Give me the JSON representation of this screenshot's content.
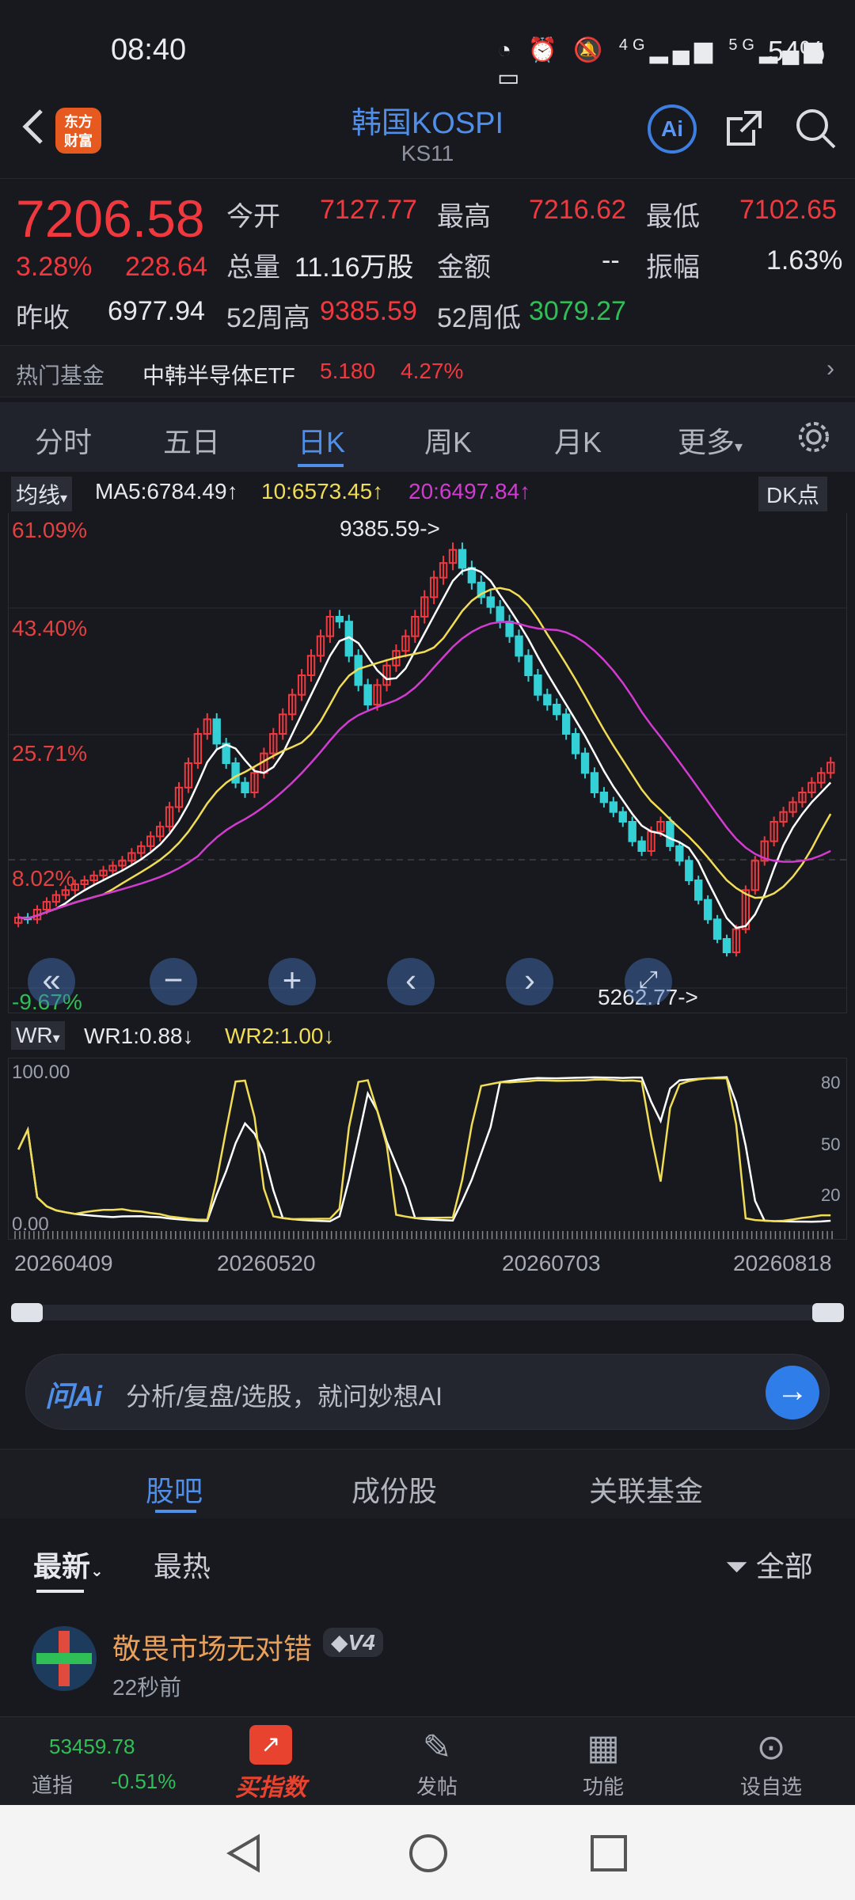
{
  "status": {
    "time": "08:40",
    "network1": "4G",
    "network2": "5G",
    "battery": "54%"
  },
  "header": {
    "logo_top": "东方",
    "logo_bottom": "财富",
    "title": "韩国KOSPI",
    "subtitle": "KS11",
    "ai_label": "Ai"
  },
  "quote": {
    "price": "7206.58",
    "change_pct": "3.28%",
    "change_abs": "228.64",
    "open_label": "今开",
    "open": "7127.77",
    "high_label": "最高",
    "high": "7216.62",
    "low_label": "最低",
    "low": "7102.65",
    "volume_label": "总量",
    "volume": "11.16万股",
    "amount_label": "金额",
    "amount": "--",
    "amp_label": "振幅",
    "amp": "1.63%",
    "prev_label": "昨收",
    "prev": "6977.94",
    "w52h_label": "52周高",
    "w52h": "9385.59",
    "w52l_label": "52周低",
    "w52l": "3079.27"
  },
  "hot_fund": {
    "label": "热门基金",
    "name": "中韩半导体ETF",
    "price": "5.180",
    "pct": "4.27%"
  },
  "period_tabs": [
    "分时",
    "五日",
    "日K",
    "周K",
    "月K",
    "更多"
  ],
  "active_tab": "日K",
  "ma": {
    "selector": "均线",
    "ma5": "MA5:6784.49↑",
    "ma10": "10:6573.45↑",
    "ma20": "20:6497.84↑",
    "dk": "DK点"
  },
  "chart_data": {
    "type": "candlestick",
    "pct_labels": [
      "61.09%",
      "43.40%",
      "25.71%",
      "8.02%",
      "-9.67%"
    ],
    "high_marker": "9385.59->",
    "low_marker": "5262.77->",
    "date_labels": [
      "20260409",
      "20260520",
      "20260703",
      "20260818"
    ],
    "close_values": [
      5620,
      5600,
      5700,
      5780,
      5850,
      5900,
      5960,
      6000,
      6050,
      6100,
      6150,
      6200,
      6280,
      6350,
      6450,
      6550,
      6750,
      6950,
      7200,
      7500,
      7650,
      7400,
      7200,
      7000,
      6900,
      7100,
      7300,
      7500,
      7700,
      7900,
      8100,
      8300,
      8500,
      8700,
      8650,
      8300,
      8000,
      7800,
      8000,
      8200,
      8350,
      8500,
      8700,
      8900,
      9100,
      9250,
      9385,
      9200,
      9050,
      8900,
      8800,
      8650,
      8500,
      8300,
      8100,
      7900,
      7800,
      7700,
      7500,
      7300,
      7100,
      6900,
      6800,
      6700,
      6600,
      6400,
      6300,
      6500,
      6600,
      6350,
      6200,
      6000,
      5800,
      5600,
      5400,
      5262,
      5500,
      5900,
      6200,
      6400,
      6600,
      6700,
      6800,
      6900,
      7000,
      7100,
      7206
    ],
    "wr": {
      "selector": "WR",
      "wr1": "WR1:0.88↓",
      "wr2": "WR2:1.00↓",
      "y_labels_left": [
        "100.00",
        "0.00"
      ],
      "y_labels_right": [
        "80",
        "50",
        "20"
      ]
    }
  },
  "ai_ask": {
    "logo": "问Ai",
    "placeholder": "分析/复盘/选股，就问妙想AI"
  },
  "bottom_tabs": [
    "股吧",
    "成份股",
    "关联基金"
  ],
  "sort": {
    "latest": "最新",
    "hottest": "最热",
    "filter": "全部"
  },
  "post": {
    "user": "敬畏市场无对错",
    "level": "V4",
    "time": "22秒前"
  },
  "bottom_nav": {
    "index_value": "53459.78",
    "index_name": "道指",
    "index_pct": "-0.51%",
    "buy": "买指数",
    "post": "发帖",
    "func": "功能",
    "watch": "设自选"
  }
}
